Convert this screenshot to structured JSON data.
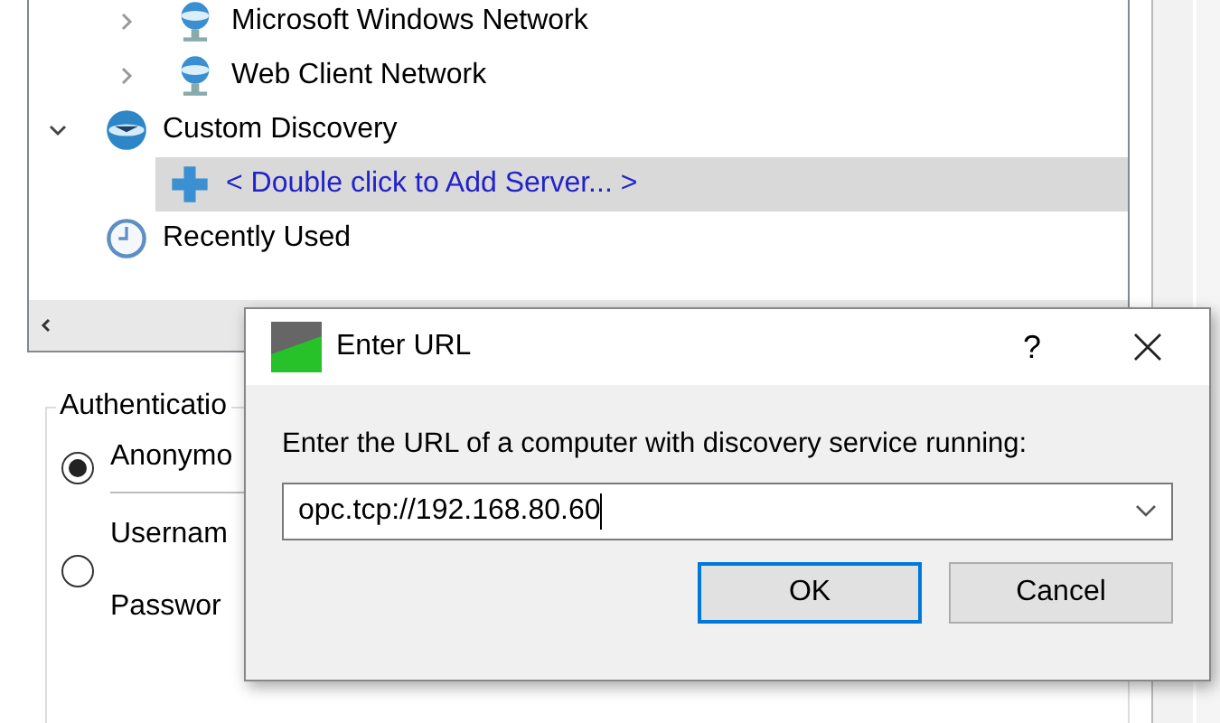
{
  "tree": {
    "items": [
      {
        "label": "Microsoft Windows Network",
        "kind": "network",
        "expanded": false,
        "selected": false
      },
      {
        "label": "Web Client Network",
        "kind": "network",
        "expanded": false,
        "selected": false
      },
      {
        "label": "Custom Discovery",
        "kind": "discovery",
        "expanded": true,
        "selected": false,
        "children": [
          {
            "label": "< Double click to Add Server... >",
            "kind": "add",
            "selected": true
          }
        ]
      },
      {
        "label": "Recently Used",
        "kind": "recent",
        "selected": false
      }
    ]
  },
  "authentication": {
    "title": "Authenticatio",
    "options": [
      {
        "label": "Anonymo",
        "selected": true,
        "kind": "single"
      },
      {
        "label": "Usernam",
        "second_label": "Passwor",
        "selected": false,
        "kind": "double"
      }
    ]
  },
  "dialog": {
    "title": "Enter URL",
    "help": "?",
    "prompt": "Enter the URL of a computer with discovery service running:",
    "url": "opc.tcp://192.168.80.60",
    "buttons": [
      {
        "label": "OK",
        "default": true
      },
      {
        "label": "Cancel",
        "default": false
      }
    ]
  }
}
